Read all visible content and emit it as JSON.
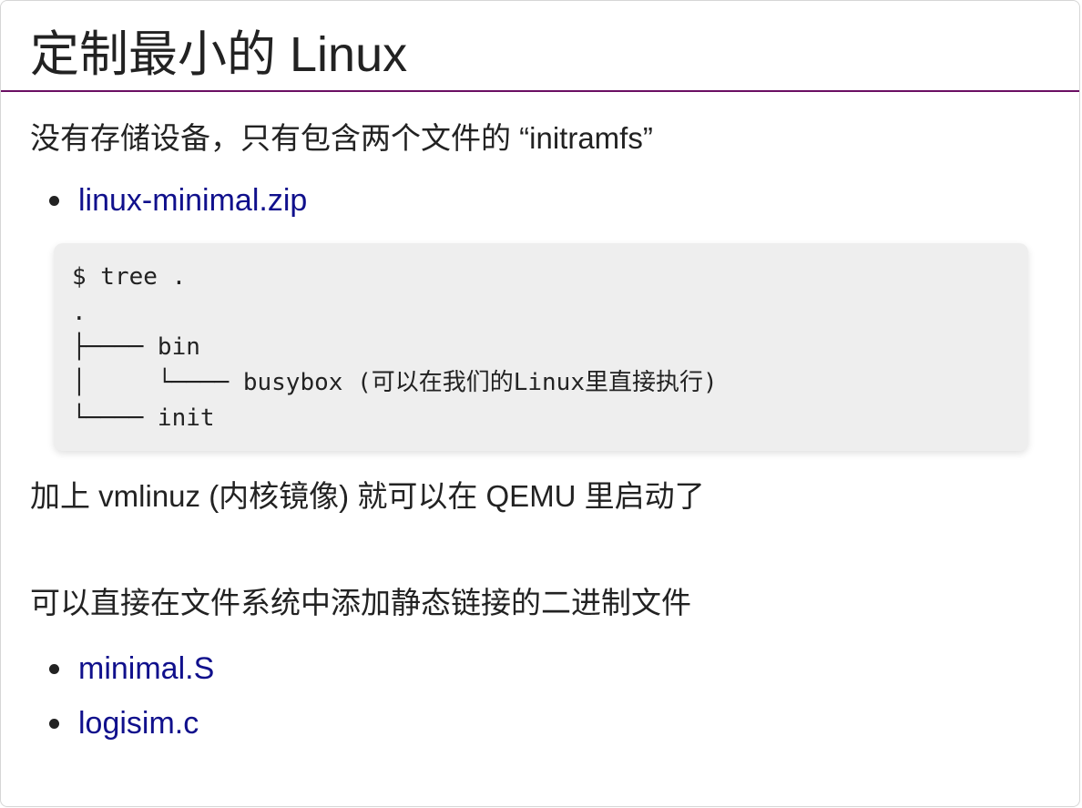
{
  "slide": {
    "title": "定制最小的 Linux",
    "intro_text": "没有存储设备，只有包含两个文件的 “initramfs”",
    "links_top": [
      {
        "label": "linux-minimal.zip"
      }
    ],
    "code_lines": [
      "$ tree .",
      ".",
      "├──── bin",
      "│     └──── busybox (可以在我们的Linux里直接执行)",
      "└──── init"
    ],
    "boot_text": "加上 vmlinuz (内核镜像) 就可以在 QEMU 里启动了",
    "static_text": "可以直接在文件系统中添加静态链接的二进制文件",
    "links_bottom": [
      {
        "label": "minimal.S"
      },
      {
        "label": "logisim.c"
      }
    ]
  },
  "colors": {
    "title_rule": "#6b0f63",
    "link": "#10108c",
    "code_background": "#eeeeee",
    "text": "#222222"
  }
}
